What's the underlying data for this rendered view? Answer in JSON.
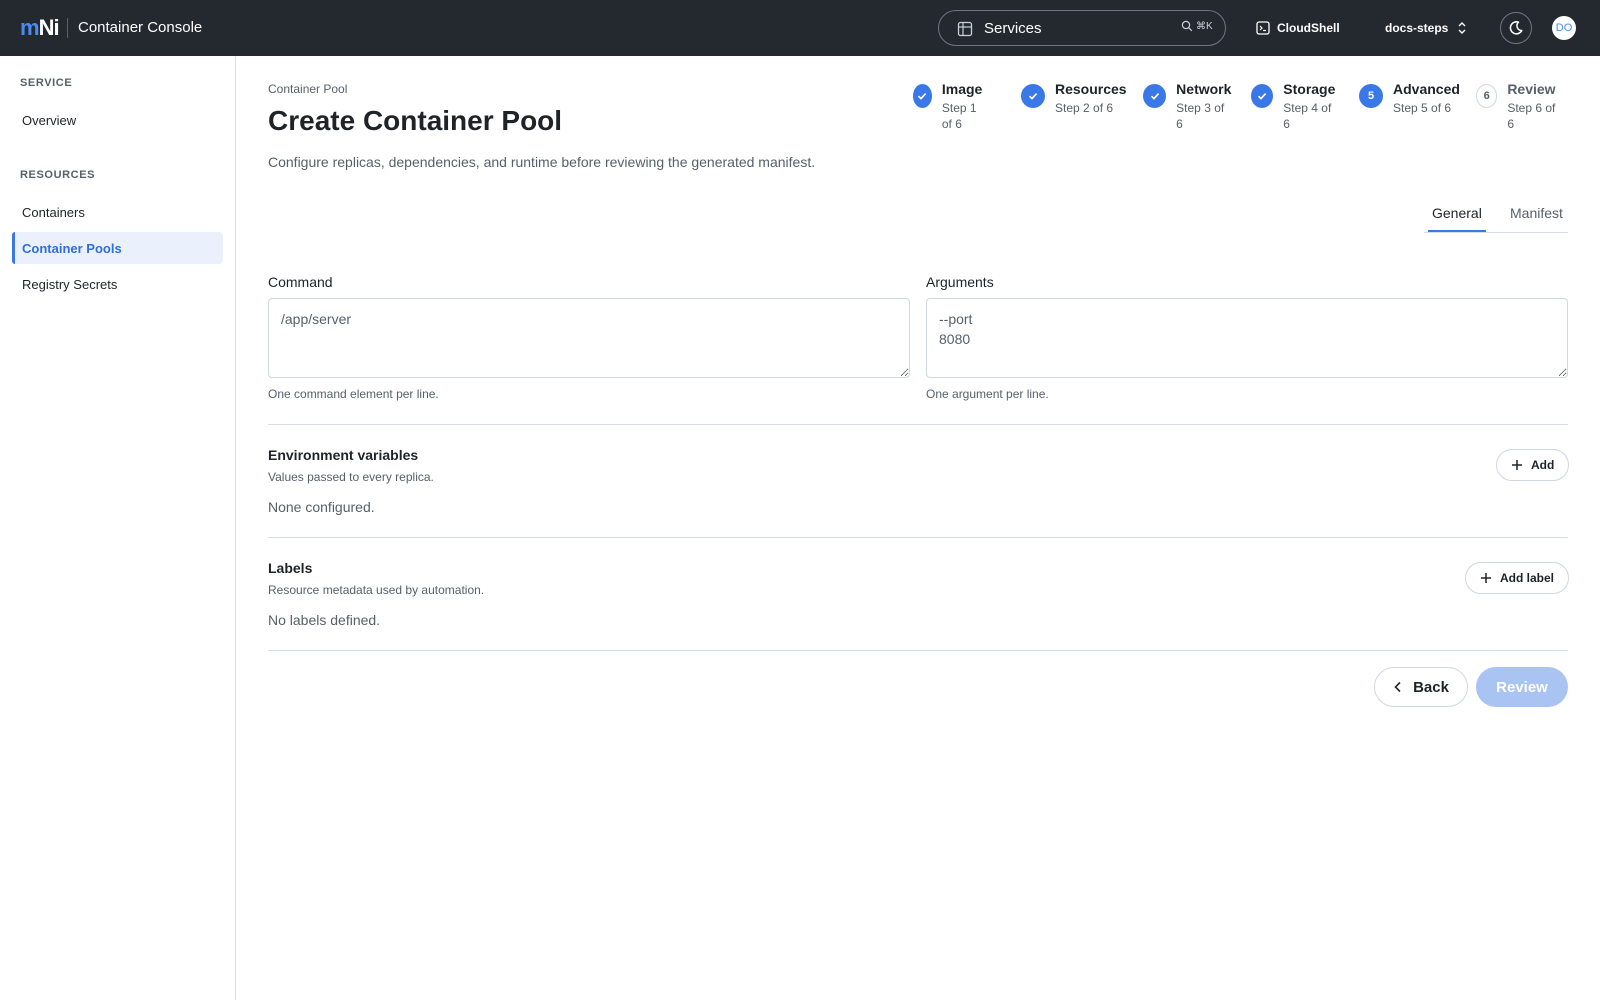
{
  "header": {
    "logo_m": "m",
    "logo_n": "Ni",
    "app_title": "Container Console",
    "search_value": "Services",
    "search_shortcut": "⌘K",
    "cloudshell_label": "CloudShell",
    "project_name": "docs-steps",
    "avatar_initials": "DO"
  },
  "sidebar": {
    "sections": [
      {
        "heading": "SERVICE",
        "items": [
          {
            "label": "Overview",
            "active": false
          }
        ]
      },
      {
        "heading": "RESOURCES",
        "items": [
          {
            "label": "Containers",
            "active": false
          },
          {
            "label": "Container Pools",
            "active": true
          },
          {
            "label": "Registry Secrets",
            "active": false
          }
        ]
      }
    ]
  },
  "page": {
    "breadcrumb": "Container Pool",
    "title": "Create Container Pool",
    "description": "Configure replicas, dependencies, and runtime before reviewing the generated manifest."
  },
  "steps": [
    {
      "name": "Image",
      "sub": "Step 1 of 6",
      "status": "done",
      "number": "1"
    },
    {
      "name": "Resources",
      "sub": "Step 2 of 6",
      "status": "done",
      "number": "2"
    },
    {
      "name": "Network",
      "sub": "Step 3 of 6",
      "status": "done",
      "number": "3"
    },
    {
      "name": "Storage",
      "sub": "Step 4 of 6",
      "status": "done",
      "number": "4"
    },
    {
      "name": "Advanced",
      "sub": "Step 5 of 6",
      "status": "current",
      "number": "5"
    },
    {
      "name": "Review",
      "sub": "Step 6 of 6",
      "status": "todo",
      "number": "6"
    }
  ],
  "tabs": [
    {
      "label": "General",
      "active": true
    },
    {
      "label": "Manifest",
      "active": false
    }
  ],
  "form": {
    "command": {
      "label": "Command",
      "value": "/app/server",
      "hint": "One command element per line."
    },
    "arguments": {
      "label": "Arguments",
      "value": "--port\n8080",
      "hint": "One argument per line."
    }
  },
  "env": {
    "title": "Environment variables",
    "subtitle": "Values passed to every replica.",
    "empty": "None configured.",
    "add_label": "Add"
  },
  "labels": {
    "title": "Labels",
    "subtitle": "Resource metadata used by automation.",
    "empty": "No labels defined.",
    "add_label": "Add label"
  },
  "footer": {
    "back_label": "Back",
    "review_label": "Review"
  },
  "colors": {
    "topbar": "#24292f",
    "accent": "#3b78e7",
    "review_disabled": "#a9c3f3"
  }
}
